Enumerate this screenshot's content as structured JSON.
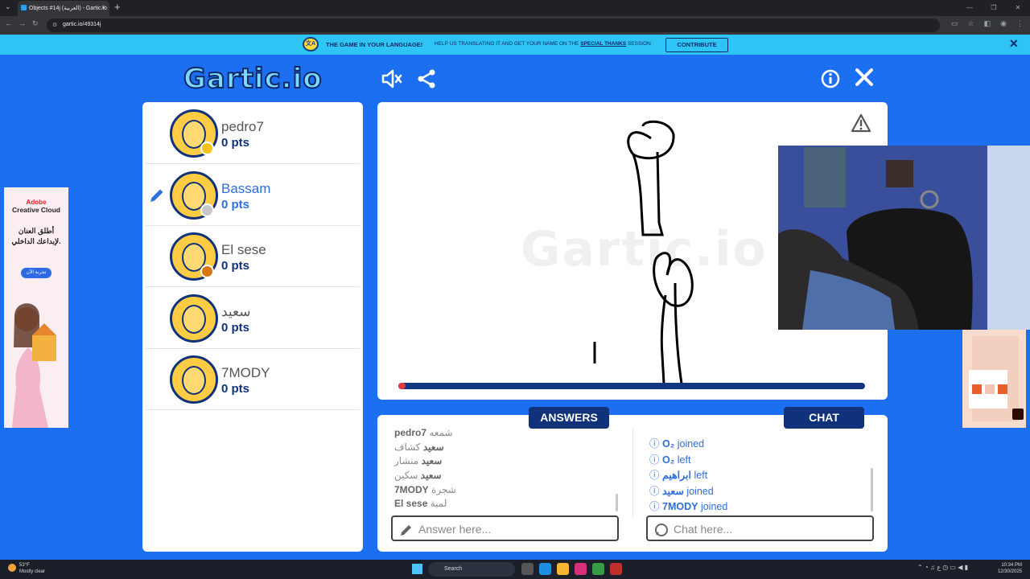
{
  "browser": {
    "tab_title": "Objects #14j (العربية) - Gartic.io",
    "url": "gartic.io/49314j"
  },
  "banner": {
    "title": "THE GAME IN YOUR LANGUAGE!",
    "text_before": "HELP US TRANSLATING IT AND GET YOUR NAME ON THE ",
    "text_link": "SPECIAL THANKS",
    "text_after": " SESSION",
    "button": "CONTRIBUTE"
  },
  "logo": "Gartic.io",
  "canvas_watermark": "Gartic.io",
  "players": [
    {
      "name": "pedro7",
      "points": "0 pts",
      "dot_color": "#f5c21b",
      "active": false
    },
    {
      "name": "Bassam",
      "points": "0 pts",
      "dot_color": "#c8c8c8",
      "active": true
    },
    {
      "name": "El sese",
      "points": "0 pts",
      "dot_color": "#d87711",
      "active": false
    },
    {
      "name": "سعيد",
      "points": "0 pts",
      "dot_color": "",
      "active": false
    },
    {
      "name": "7MODY",
      "points": "0 pts",
      "dot_color": "",
      "active": false
    }
  ],
  "timer_progress": 0.015,
  "tabs": {
    "answers": "ANSWERS",
    "chat": "CHAT"
  },
  "answers": [
    {
      "user": "pedro7",
      "text": "شمعه"
    },
    {
      "user": "سعيد",
      "text": "كشاف"
    },
    {
      "user": "سعيد",
      "text": "منشار"
    },
    {
      "user": "سعيد",
      "text": "سكين"
    },
    {
      "user": "7MODY",
      "text": "شجرة"
    },
    {
      "user": "El sese",
      "text": "لمبة"
    }
  ],
  "chat": [
    {
      "user": "O₂",
      "action": "joined"
    },
    {
      "user": "O₂",
      "action": "left"
    },
    {
      "user": "ابراهيم",
      "action": "left"
    },
    {
      "user": "سعيد",
      "action": "joined"
    },
    {
      "user": "7MODY",
      "action": "joined"
    }
  ],
  "answer_input": {
    "placeholder": "Answer here..."
  },
  "chat_input": {
    "placeholder": "Chat here..."
  },
  "ad_left": {
    "brand": "Adobe",
    "product": "Creative Cloud",
    "headline": "أطلق العنان لإبداعك الداخلي.",
    "button": "تجربة الآن"
  },
  "taskbar": {
    "temp": "53°F",
    "weather": "Mostly clear",
    "search": "Search",
    "time": "10:34 PM",
    "date": "12/30/2025"
  }
}
